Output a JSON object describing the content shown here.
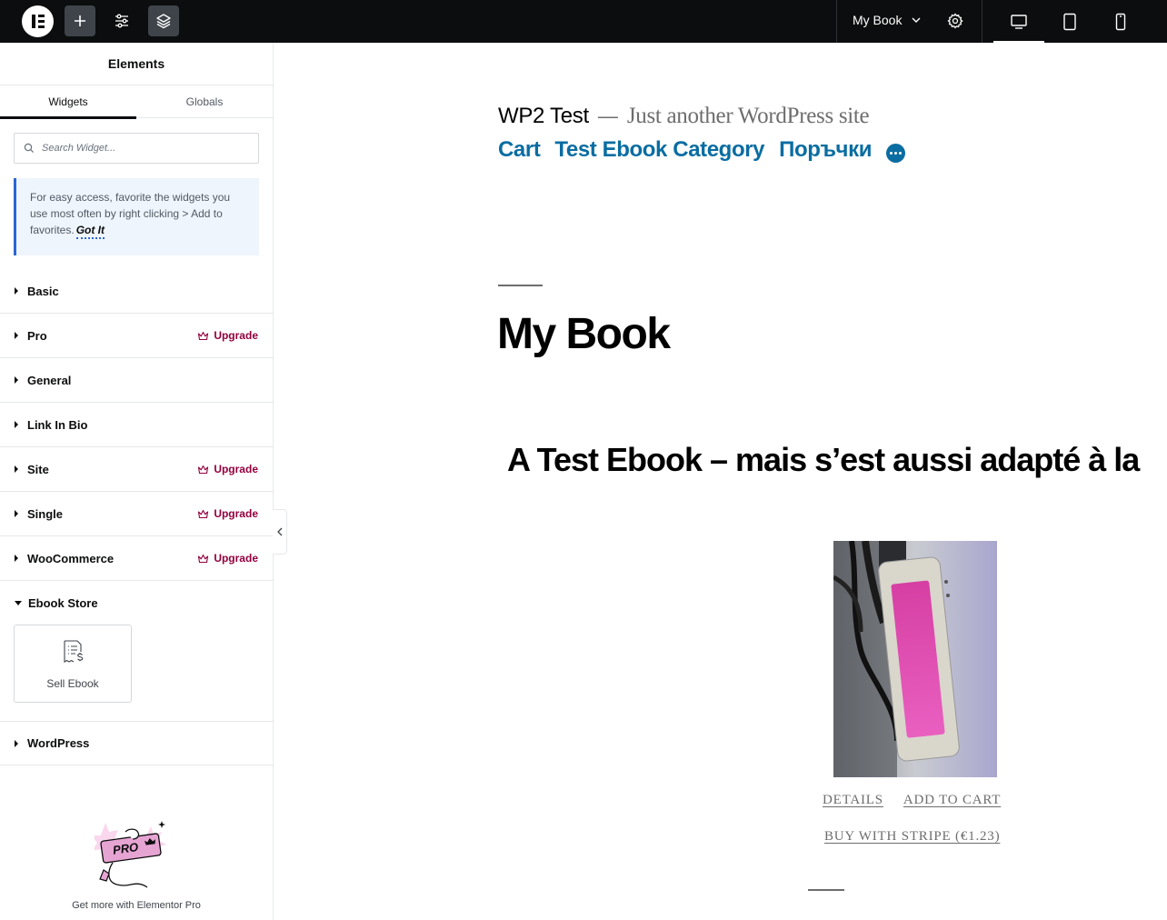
{
  "topbar": {
    "page_name": "My Book",
    "colors": {
      "background": "#0c0d0e",
      "active_button": "#3f444b"
    }
  },
  "panel": {
    "title": "Elements",
    "tabs": [
      {
        "label": "Widgets",
        "active": true
      },
      {
        "label": "Globals",
        "active": false
      }
    ],
    "search": {
      "placeholder": "Search Widget..."
    },
    "notice": {
      "text": "For easy access, favorite the widgets you use most often by right clicking > Add to favorites.",
      "link": "Got It"
    },
    "categories": [
      {
        "label": "Basic",
        "upgrade": false,
        "open": false
      },
      {
        "label": "Pro",
        "upgrade": true,
        "open": false
      },
      {
        "label": "General",
        "upgrade": false,
        "open": false
      },
      {
        "label": "Link In Bio",
        "upgrade": false,
        "open": false
      },
      {
        "label": "Site",
        "upgrade": true,
        "open": false
      },
      {
        "label": "Single",
        "upgrade": true,
        "open": false
      },
      {
        "label": "WooCommerce",
        "upgrade": true,
        "open": false
      },
      {
        "label": "Ebook Store",
        "upgrade": false,
        "open": true
      },
      {
        "label": "WordPress",
        "upgrade": false,
        "open": false
      }
    ],
    "upgrade_label": "Upgrade",
    "widget": {
      "label": "Sell Ebook",
      "icon": "invoice-dollar-icon"
    },
    "promo": {
      "text": "Get more with Elementor Pro",
      "badge": "PRO"
    },
    "accent_color": "#93003f"
  },
  "canvas": {
    "site_name": "WP2 Test",
    "site_separator": "—",
    "tagline": "Just another WordPress site",
    "menu": [
      "Cart",
      "Test Ebook Category",
      "Поръчки"
    ],
    "page_title": "My Book",
    "ebook_title": "A Test Ebook – mais s’est aussi adapté à la",
    "details_link": "DETAILS",
    "add_to_cart_link": "ADD TO CART",
    "stripe_link": "BUY WITH STRIPE (€1.23)",
    "link_color": "#0a6da2"
  }
}
